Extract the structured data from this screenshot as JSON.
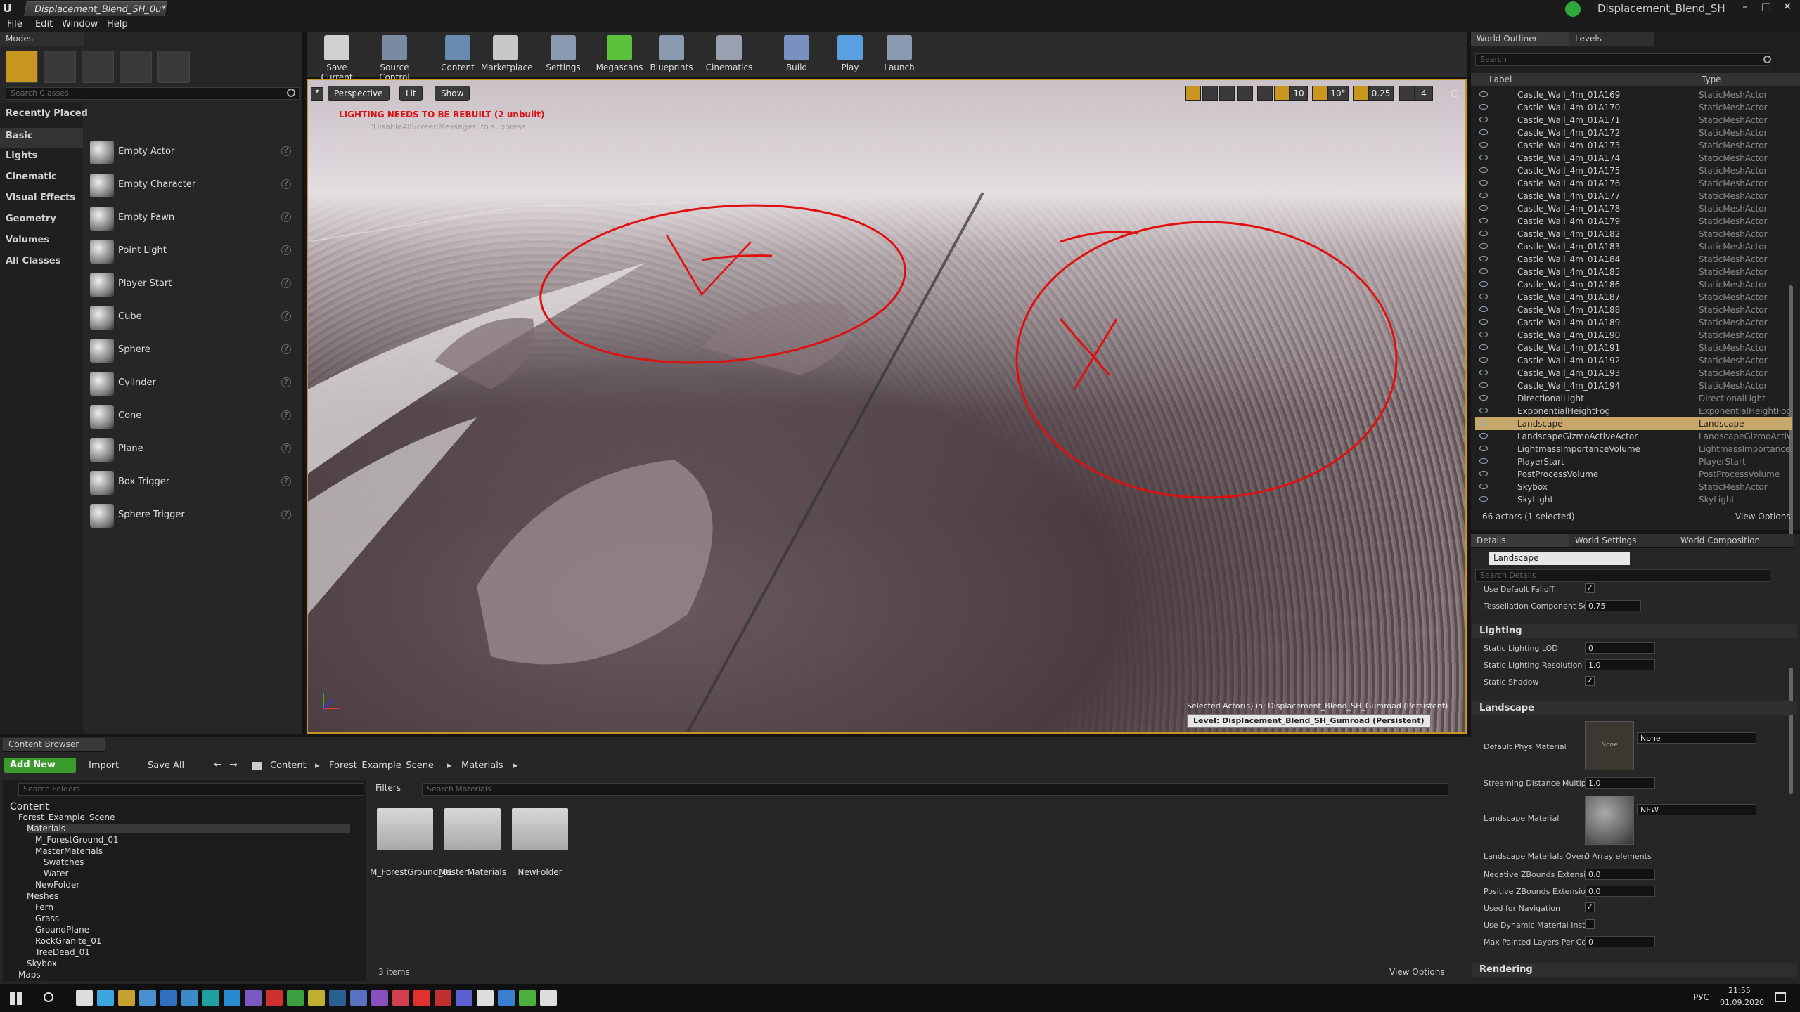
{
  "window": {
    "tab_title": "Displacement_Blend_SH_0u*",
    "project_name": "Displacement_Blend_SH",
    "controls": [
      "–",
      "□",
      "✕"
    ]
  },
  "menu": [
    "File",
    "Edit",
    "Window",
    "Help"
  ],
  "modes": {
    "tab": "Modes",
    "search_placeholder": "Search Classes",
    "categories": [
      "Recently Placed",
      "Basic",
      "Lights",
      "Cinematic",
      "Visual Effects",
      "Geometry",
      "Volumes",
      "All Classes"
    ],
    "items": [
      "Empty Actor",
      "Empty Character",
      "Empty Pawn",
      "Point Light",
      "Player Start",
      "Cube",
      "Sphere",
      "Cylinder",
      "Cone",
      "Plane",
      "Box Trigger",
      "Sphere Trigger"
    ]
  },
  "toolbar": {
    "buttons": [
      "Save Current",
      "Source Control",
      "Content",
      "Marketplace",
      "Settings",
      "Megascans",
      "Blueprints",
      "Cinematics",
      "Build",
      "Play",
      "Launch"
    ]
  },
  "viewport": {
    "perspective": "Perspective",
    "lit": "Lit",
    "show": "Show",
    "warning": "LIGHTING NEEDS TO BE REBUILT (2 unbuilt)",
    "suppress": "'DisableAllScreenMessages' to suppress",
    "snap_grid": "10",
    "snap_rot": "10°",
    "snap_scale": "0.25",
    "cam_speed": "4",
    "selected_text": "Selected Actor(s) in: Displacement_Blend_SH_Gumroad (Persistent)",
    "level_text": "Level:  Displacement_Blend_SH_Gumroad (Persistent)"
  },
  "outliner": {
    "tab": "World Outliner",
    "tab2": "Levels",
    "search_placeholder": "Search",
    "col_label": "Label",
    "col_type": "Type",
    "rows": [
      [
        "Castle_Wall_4m_01A169",
        "StaticMeshActor"
      ],
      [
        "Castle_Wall_4m_01A170",
        "StaticMeshActor"
      ],
      [
        "Castle_Wall_4m_01A171",
        "StaticMeshActor"
      ],
      [
        "Castle_Wall_4m_01A172",
        "StaticMeshActor"
      ],
      [
        "Castle_Wall_4m_01A173",
        "StaticMeshActor"
      ],
      [
        "Castle_Wall_4m_01A174",
        "StaticMeshActor"
      ],
      [
        "Castle_Wall_4m_01A175",
        "StaticMeshActor"
      ],
      [
        "Castle_Wall_4m_01A176",
        "StaticMeshActor"
      ],
      [
        "Castle_Wall_4m_01A177",
        "StaticMeshActor"
      ],
      [
        "Castle_Wall_4m_01A178",
        "StaticMeshActor"
      ],
      [
        "Castle_Wall_4m_01A179",
        "StaticMeshActor"
      ],
      [
        "Castle_Wall_4m_01A182",
        "StaticMeshActor"
      ],
      [
        "Castle_Wall_4m_01A183",
        "StaticMeshActor"
      ],
      [
        "Castle_Wall_4m_01A184",
        "StaticMeshActor"
      ],
      [
        "Castle_Wall_4m_01A185",
        "StaticMeshActor"
      ],
      [
        "Castle_Wall_4m_01A186",
        "StaticMeshActor"
      ],
      [
        "Castle_Wall_4m_01A187",
        "StaticMeshActor"
      ],
      [
        "Castle_Wall_4m_01A188",
        "StaticMeshActor"
      ],
      [
        "Castle_Wall_4m_01A189",
        "StaticMeshActor"
      ],
      [
        "Castle_Wall_4m_01A190",
        "StaticMeshActor"
      ],
      [
        "Castle_Wall_4m_01A191",
        "StaticMeshActor"
      ],
      [
        "Castle_Wall_4m_01A192",
        "StaticMeshActor"
      ],
      [
        "Castle_Wall_4m_01A193",
        "StaticMeshActor"
      ],
      [
        "Castle_Wall_4m_01A194",
        "StaticMeshActor"
      ],
      [
        "DirectionalLight",
        "DirectionalLight"
      ],
      [
        "ExponentialHeightFog",
        "ExponentialHeightFog"
      ],
      [
        "Landscape",
        "Landscape"
      ],
      [
        "LandscapeGizmoActiveActor",
        "LandscapeGizmoActiv"
      ],
      [
        "LightmassImportanceVolume",
        "LightmassImportance"
      ],
      [
        "PlayerStart",
        "PlayerStart"
      ],
      [
        "PostProcessVolume",
        "PostProcessVolume"
      ],
      [
        "Skybox",
        "StaticMeshActor"
      ],
      [
        "SkyLight",
        "SkyLight"
      ]
    ],
    "selected_index": 26,
    "count": "66 actors (1 selected)",
    "view_options": "View Options"
  },
  "details": {
    "tab": "Details",
    "tab2": "World Settings",
    "tab3": "World Composition",
    "name": "Landscape",
    "search_placeholder": "Search Details",
    "use_default_falloff": "Use Default Falloff",
    "tess_label": "Tessellation Component Sc",
    "tess_value": "0.75",
    "lighting": "Lighting",
    "lod_label": "Static Lighting LOD",
    "lod_value": "0",
    "res_label": "Static Lighting Resolution",
    "res_value": "1.0",
    "shadow_label": "Static Shadow",
    "landscape": "Landscape",
    "phys_label": "Default Phys Material",
    "phys_value": "None",
    "phys_thumb": "None",
    "stream_label": "Streaming Distance Multipli",
    "stream_value": "1.0",
    "mat_label": "Landscape Material",
    "mat_value": "NEW",
    "overr_label": "Landscape Materials Overri",
    "overr_value": "0 Array elements",
    "negz_label": "Negative ZBounds Extensio",
    "negz_value": "0.0",
    "posz_label": "Positive ZBounds Extensio",
    "posz_value": "0.0",
    "nav_label": "Used for Navigation",
    "dyn_label": "Use Dynamic Material Insta",
    "maxp_label": "Max Painted Layers Per Cor",
    "maxp_value": "0",
    "rendering": "Rendering"
  },
  "content": {
    "tab": "Content Browser",
    "add_new": "Add New",
    "import": "Import",
    "save_all": "Save All",
    "path": [
      "Content",
      "Forest_Example_Scene",
      "Materials"
    ],
    "search_folders": "Search Folders",
    "filters": "Filters",
    "search_materials": "Search Materials",
    "tree": [
      "Content",
      "Forest_Example_Scene",
      "Materials",
      "M_ForestGround_01",
      "MasterMaterials",
      "Swatches",
      "Water",
      "NewFolder",
      "Meshes",
      "Fern",
      "Grass",
      "GroundPlane",
      "RockGranite_01",
      "TreeDead_01",
      "Skybox",
      "Maps"
    ],
    "folders": [
      "M_ForestGround_01",
      "MasterMaterials",
      "NewFolder"
    ],
    "items_count": "3 items",
    "view_options": "View Options"
  },
  "taskbar": {
    "lang": "РУС",
    "time": "21:55",
    "date": "01.09.2020"
  },
  "colors": {
    "accent": "#c8961e",
    "annotation": "#e01010",
    "selection": "#c8a86a",
    "megascans": "#5cc23c"
  }
}
